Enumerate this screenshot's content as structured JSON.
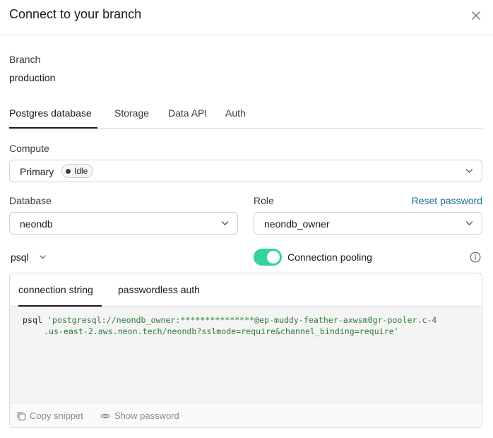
{
  "dialog": {
    "title": "Connect to your branch"
  },
  "branch": {
    "label": "Branch",
    "value": "production"
  },
  "tabs": [
    {
      "label": "Postgres database",
      "active": true
    },
    {
      "label": "Storage",
      "active": false
    },
    {
      "label": "Data API",
      "active": false
    },
    {
      "label": "Auth",
      "active": false
    }
  ],
  "compute": {
    "label": "Compute",
    "value": "Primary",
    "status": "Idle"
  },
  "database": {
    "label": "Database",
    "value": "neondb"
  },
  "role": {
    "label": "Role",
    "value": "neondb_owner",
    "reset_label": "Reset password"
  },
  "client": {
    "value": "psql"
  },
  "pooling": {
    "label": "Connection pooling",
    "enabled": true
  },
  "code_tabs": [
    {
      "label": "connection string",
      "active": true
    },
    {
      "label": "passwordless auth",
      "active": false
    }
  ],
  "snippet": {
    "command": "psql ",
    "line1": "'postgresql://neondb_owner:***************@ep-muddy-feather-axwsm0gr-pooler.c-4",
    "line2": ".us-east-2.aws.neon.tech/neondb?sslmode=require&channel_binding=require'"
  },
  "footer": {
    "copy_label": "Copy snippet",
    "show_label": "Show password"
  },
  "colors": {
    "toggle": "#34d399",
    "link": "#1f6f9e",
    "code_string": "#2e7d32"
  },
  "icons": [
    "close-icon",
    "chevron-down-icon",
    "info-icon",
    "copy-icon",
    "eye-icon"
  ]
}
